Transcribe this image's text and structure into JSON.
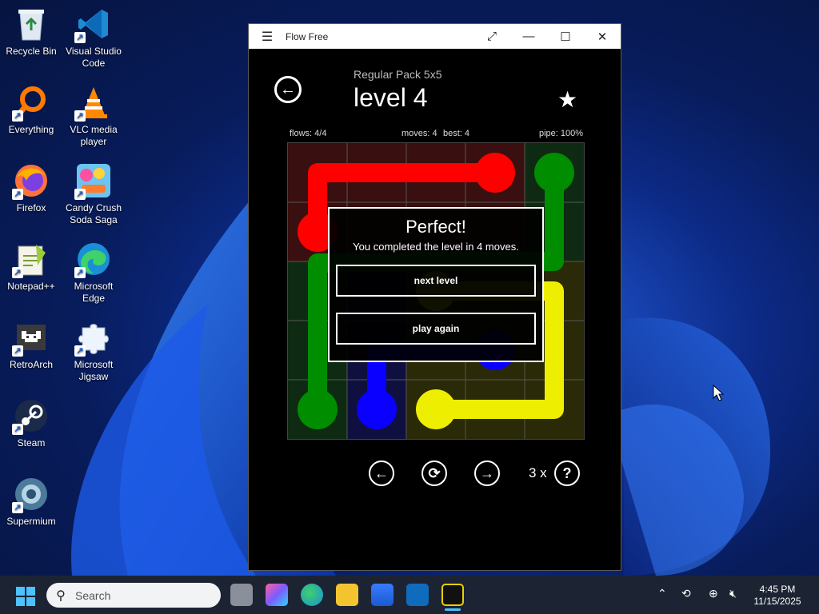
{
  "desktop": {
    "icons": [
      {
        "label": "Recycle Bin",
        "icon": "recycle-bin-icon"
      },
      {
        "label": "Visual Studio Code",
        "icon": "vscode-icon"
      },
      {
        "label": "Everything",
        "icon": "search-magnifier-icon"
      },
      {
        "label": "VLC media player",
        "icon": "vlc-cone-icon"
      },
      {
        "label": "Firefox",
        "icon": "firefox-icon"
      },
      {
        "label": "Candy Crush Soda Saga",
        "icon": "candy-crush-icon"
      },
      {
        "label": "Notepad++",
        "icon": "notepad-plus-plus-icon"
      },
      {
        "label": "Microsoft Edge",
        "icon": "edge-icon"
      },
      {
        "label": "RetroArch",
        "icon": "retroarch-invader-icon"
      },
      {
        "label": "Microsoft Jigsaw",
        "icon": "jigsaw-puzzle-icon"
      },
      {
        "label": "Steam",
        "icon": "steam-icon"
      },
      {
        "label": "Supermium",
        "icon": "supermium-icon"
      }
    ]
  },
  "window": {
    "title": "Flow Free",
    "pack": "Regular Pack 5x5",
    "level": "level 4",
    "stats": {
      "flows": "flows: 4/4",
      "moves": "moves: 4",
      "best": "best: 4",
      "pipe": "pipe: 100%"
    },
    "dialog": {
      "heading": "Perfect!",
      "message": "You completed the level in 4 moves.",
      "next_label": "next level",
      "again_label": "play again"
    },
    "hints_count": "3 x",
    "colors": {
      "red": "#ff0000",
      "green": "#008d00",
      "blue": "#0a00ff",
      "yellow": "#eeee00"
    }
  },
  "taskbar": {
    "search_placeholder": "Search",
    "time": "4:45 PM",
    "date": "11/15/2025"
  }
}
